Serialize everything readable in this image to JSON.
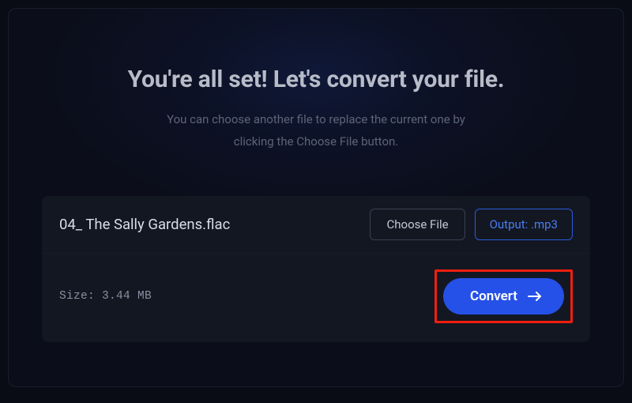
{
  "header": {
    "title": "You're all set! Let's convert your file.",
    "subtitle": "You can choose another file to replace the current one by clicking the Choose File button."
  },
  "file": {
    "name": "04_ The Sally Gardens.flac",
    "choose_label": "Choose File",
    "output_label": "Output: .mp3",
    "size_label": "Size: 3.44 MB"
  },
  "actions": {
    "convert_label": "Convert"
  }
}
